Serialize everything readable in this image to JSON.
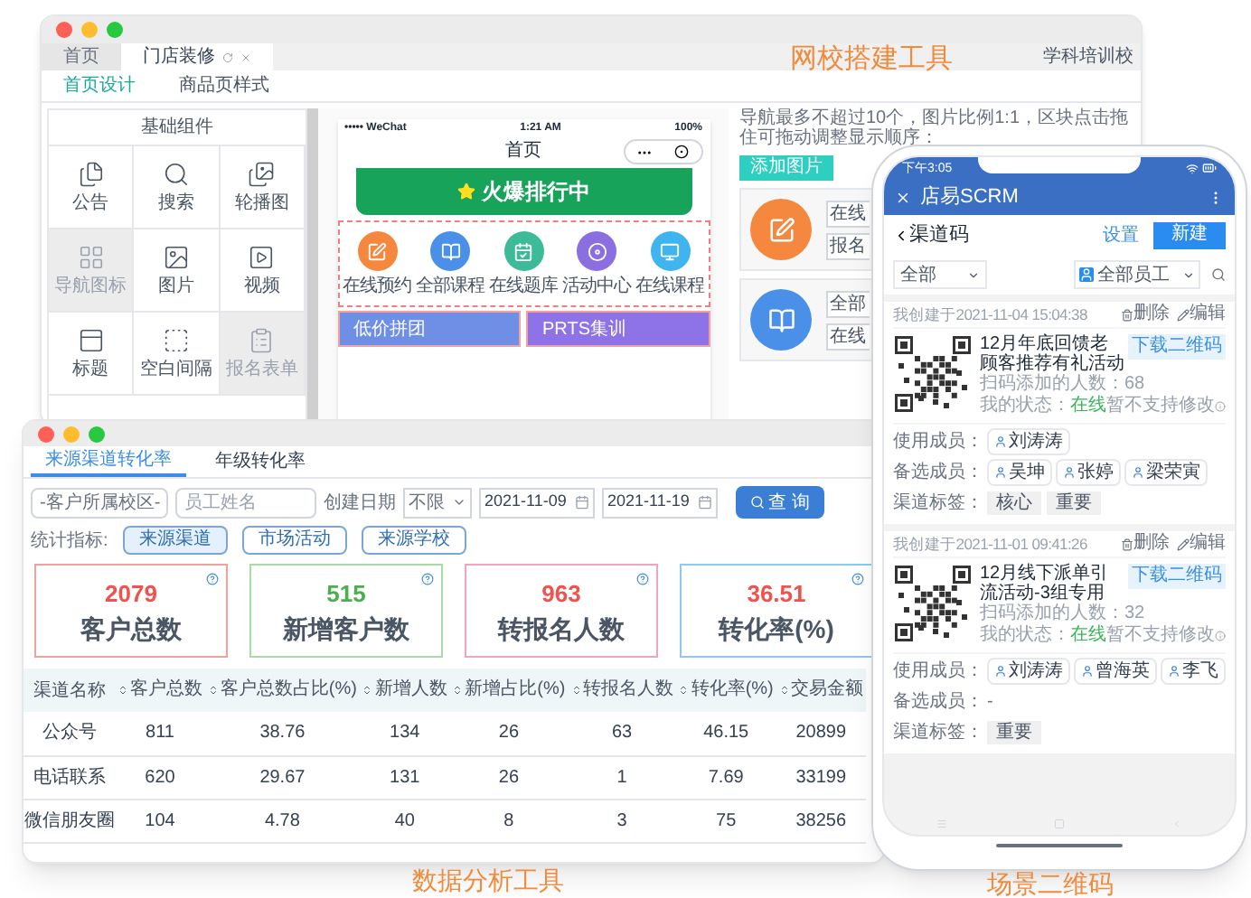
{
  "builder_window": {
    "tabs": [
      {
        "label": "首页",
        "selected": false
      },
      {
        "label": "门店装修",
        "selected": true
      }
    ],
    "account": "学科培训校",
    "subtabs": [
      {
        "label": "首页设计",
        "selected": true
      },
      {
        "label": "商品页样式",
        "selected": false
      }
    ],
    "components_title": "基础组件",
    "components": [
      {
        "label": "公告",
        "dimmed": false
      },
      {
        "label": "搜索",
        "dimmed": false
      },
      {
        "label": "轮播图",
        "dimmed": false
      },
      {
        "label": "导航图标",
        "dimmed": true
      },
      {
        "label": "图片",
        "dimmed": false
      },
      {
        "label": "视频",
        "dimmed": false
      },
      {
        "label": "标题",
        "dimmed": false
      },
      {
        "label": "空白间隔",
        "dimmed": false
      },
      {
        "label": "报名表单",
        "dimmed": true
      }
    ],
    "preview": {
      "carrier": "••••• WeChat",
      "time": "1:21 AM",
      "battery": "100%",
      "title": "首页",
      "banner": "火爆排行中",
      "nav": [
        {
          "label": "在线预约",
          "color": "#f5873f"
        },
        {
          "label": "全部课程",
          "color": "#4a8fe8"
        },
        {
          "label": "在线题库",
          "color": "#3dbb98"
        },
        {
          "label": "活动中心",
          "color": "#8b6ee0"
        },
        {
          "label": "在线课程",
          "color": "#3fb4ee"
        }
      ],
      "cards": [
        "低价拼团",
        "PRTS集训"
      ]
    },
    "settings": {
      "hint": "导航最多不超过10个，图片比例1:1，区块点击拖住可拖动调整显示顺序：",
      "add_button": "添加图片",
      "items": [
        {
          "color": "#f5873f",
          "fields": [
            "在线",
            "报名"
          ]
        },
        {
          "color": "#4a8fe8",
          "fields": [
            "全部",
            "在线"
          ]
        }
      ]
    }
  },
  "analytics_window": {
    "tabs": [
      {
        "label": "来源渠道转化率",
        "selected": true
      },
      {
        "label": "年级转化率",
        "selected": false
      }
    ],
    "filters": {
      "campus": "-客户所属校区-",
      "staff_placeholder": "员工姓名",
      "date_label": "创建日期",
      "date_range": "不限",
      "start": "2021-11-09",
      "end": "2021-11-19",
      "query": "查 询"
    },
    "metric_label": "统计指标:",
    "metrics": [
      {
        "label": "来源渠道",
        "selected": true
      },
      {
        "label": "市场活动",
        "selected": false
      },
      {
        "label": "来源学校",
        "selected": false
      }
    ],
    "stats": [
      {
        "value": "2079",
        "label": "客户总数",
        "color": "#f0524f"
      },
      {
        "value": "515",
        "label": "新增客户数",
        "color": "#4cae4c"
      },
      {
        "value": "963",
        "label": "转报名人数",
        "color": "#f0524f"
      },
      {
        "value": "36.51",
        "label": "转化率(%)",
        "color": "#f0524f"
      }
    ],
    "table": {
      "columns": [
        {
          "label": "渠道名称",
          "sortable": false
        },
        {
          "label": "客户总数",
          "sortable": true
        },
        {
          "label": "客户总数占比(%)",
          "sortable": true
        },
        {
          "label": "新增人数",
          "sortable": true
        },
        {
          "label": "新增占比(%)",
          "sortable": true
        },
        {
          "label": "转报名人数",
          "sortable": true
        },
        {
          "label": "转化率(%)",
          "sortable": true
        },
        {
          "label": "交易金额",
          "sortable": true
        }
      ],
      "rows": [
        [
          "公众号",
          "811",
          "38.76",
          "134",
          "26",
          "63",
          "46.15",
          "20899"
        ],
        [
          "电话联系",
          "620",
          "29.67",
          "131",
          "26",
          "1",
          "7.69",
          "33199"
        ],
        [
          "微信朋友圈",
          "104",
          "4.78",
          "40",
          "8",
          "3",
          "75",
          "38256"
        ]
      ]
    }
  },
  "scrm_phone": {
    "time": "下午3:05",
    "app_title": "店易SCRM",
    "page_title": "渠道码",
    "settings": "设置",
    "new": "新建",
    "filter": "全部",
    "staff": "全部员工",
    "codes": [
      {
        "created": "我创建于2021-11-04 15:04:38",
        "delete": "删除",
        "edit": "编辑",
        "title": "12月年底回馈老顾客推荐有礼活动",
        "download": "下载二维码",
        "scans": "扫码添加的人数：68",
        "status_label": "我的状态：",
        "status": "在线",
        "note": "暂不支持修改",
        "members_label": "使用成员：",
        "members": [
          "刘涛涛"
        ],
        "backup_label": "备选成员：",
        "backups": [
          "吴坤",
          "张婷",
          "梁荣寅"
        ],
        "tags_label": "渠道标签：",
        "tags": [
          "核心",
          "重要"
        ]
      },
      {
        "created": "我创建于2021-11-01 09:41:26",
        "delete": "删除",
        "edit": "编辑",
        "title": "12月线下派单引流活动-3组专用",
        "download": "下载二维码",
        "scans": "扫码添加的人数：32",
        "status_label": "我的状态：",
        "status": "在线",
        "note": "暂不支持修改",
        "members_label": "使用成员：",
        "members": [
          "刘涛涛",
          "曾海英",
          "李飞"
        ],
        "backup_label": "备选成员：",
        "backups_text": "-",
        "tags_label": "渠道标签：",
        "tags": [
          "重要"
        ]
      }
    ]
  },
  "captions": [
    "网校搭建工具",
    "数据分析工具",
    "场景二维码"
  ]
}
